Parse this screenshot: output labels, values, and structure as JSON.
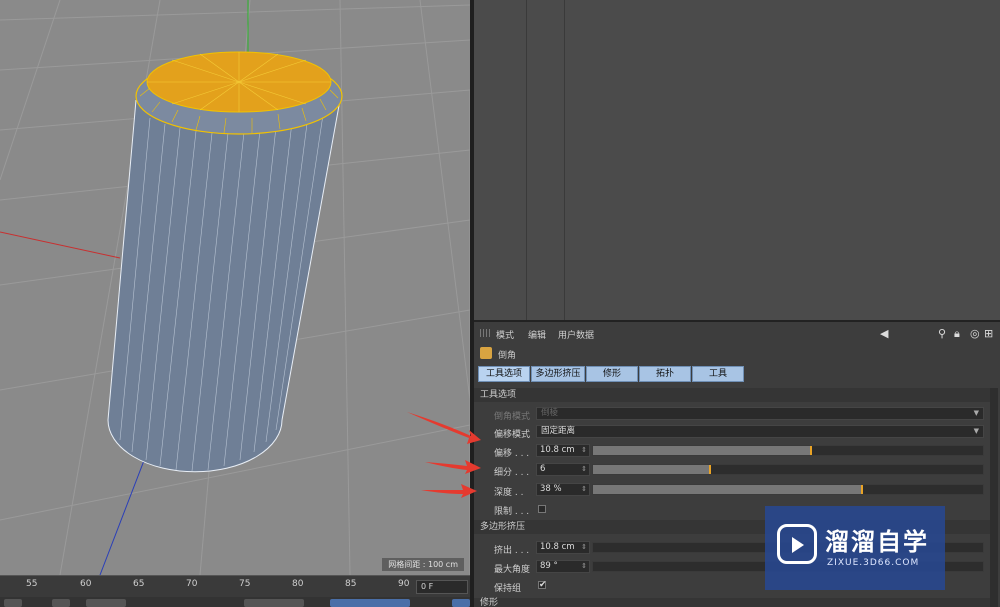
{
  "viewport": {
    "grid_spacing_label": "网格间距 : 100 cm"
  },
  "timeline": {
    "ticks": [
      "55",
      "60",
      "65",
      "70",
      "75",
      "80",
      "85",
      "90"
    ],
    "frame": "0 F"
  },
  "attribute_manager": {
    "menu": [
      "模式",
      "编辑",
      "用户数据"
    ],
    "tool_name": "倒角",
    "tabs": [
      "工具选项",
      "多边形挤压",
      "修形",
      "拓扑",
      "工具"
    ],
    "sections": {
      "tool_options": "工具选项",
      "polygon_extrude": "多边形挤压",
      "shaping": "修形"
    },
    "properties": {
      "bevel_mode": {
        "label": "倒角模式",
        "value": "倒棱"
      },
      "offset_mode": {
        "label": "偏移模式",
        "value": "固定距离"
      },
      "offset": {
        "label": "偏移 . . .",
        "value": "10.8 cm",
        "slider_fraction": 0.56
      },
      "subdivision": {
        "label": "细分 . . .",
        "value": "6",
        "slider_fraction": 0.3
      },
      "depth": {
        "label": "深度 . .",
        "value": "38 %",
        "slider_fraction": 0.69
      },
      "limit": {
        "label": "限制 . . .",
        "checked": false
      },
      "extrude": {
        "label": "挤出 . . .",
        "value": "10.8 cm"
      },
      "max_angle": {
        "label": "最大角度",
        "value": "89 °"
      },
      "preserve_groups": {
        "label": "保持组",
        "checked": true
      }
    }
  },
  "watermark": {
    "title": "溜溜自学",
    "subtitle": "ZIXUE.3D66.COM"
  },
  "colors": {
    "accent_handle": "#e9a326",
    "tab_blue": "#a8c4e4",
    "arrow_red": "#e53a2f",
    "selection_yellow": "#f2c200"
  }
}
